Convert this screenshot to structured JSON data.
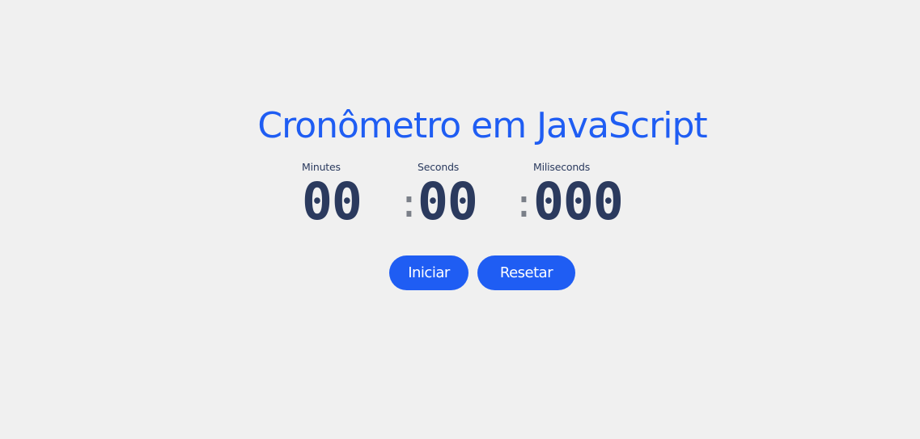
{
  "title": "Cronômetro em JavaScript",
  "timer": {
    "minutes": {
      "label": "Minutes",
      "value": "00"
    },
    "seconds": {
      "label": "Seconds",
      "value": "00"
    },
    "milliseconds": {
      "label": "Miliseconds",
      "value": "000"
    },
    "separator": ":"
  },
  "buttons": {
    "start_label": "Iniciar",
    "reset_label": "Resetar"
  },
  "colors": {
    "accent": "#1f5df3",
    "digits": "#2b3a5e",
    "background": "#f0f0f0"
  }
}
